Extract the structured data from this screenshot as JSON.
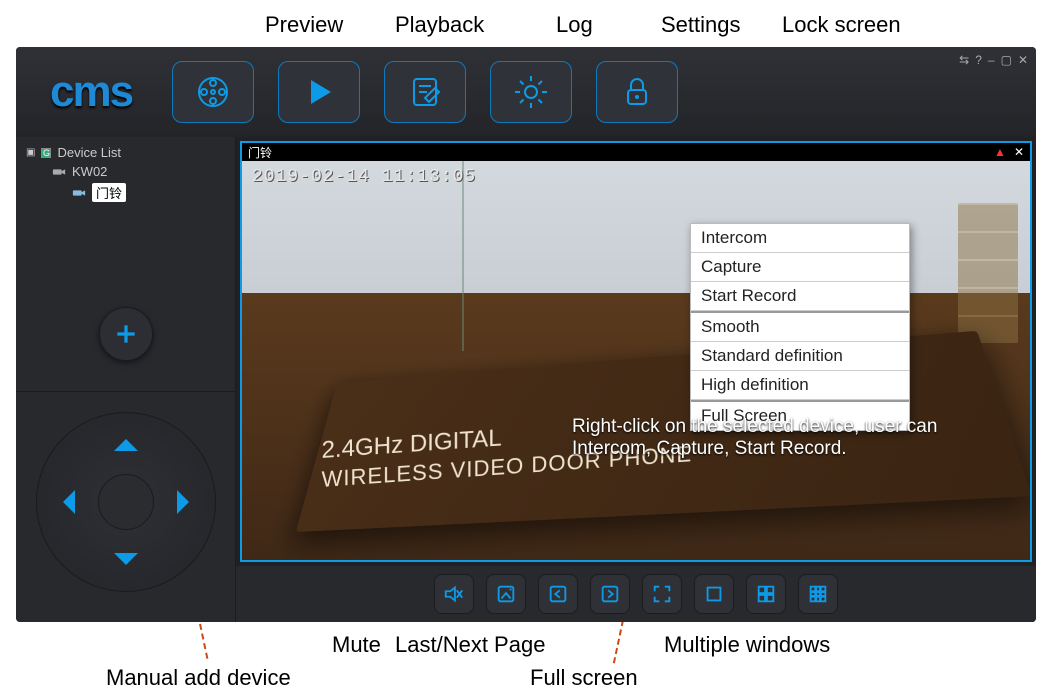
{
  "external_labels": {
    "preview": "Preview",
    "playback": "Playback",
    "log": "Log",
    "settings": "Settings",
    "lock": "Lock screen",
    "manual_add": "Manual add device",
    "mute": "Mute",
    "pages": "Last/Next Page",
    "fullscreen": "Full screen",
    "multi": "Multiple windows"
  },
  "logo_text": "cms",
  "device_tree": {
    "root": "Device List",
    "child": "KW02",
    "grandchild": "门铃"
  },
  "video": {
    "title": "门铃",
    "timestamp": "2019-02-14   11:13:05",
    "close_glyph": "✕",
    "box_line1": "2.4GHz DIGITAL",
    "box_line2": "WIRELESS VIDEO DOOR PHONE"
  },
  "caption": "Right-click on the selected device, user can Intercom, Capture, Start Record.",
  "context_menu": {
    "items": [
      "Intercom",
      "Capture",
      "Start Record",
      "Smooth",
      "Standard definition",
      "High definition",
      "Full Screen"
    ]
  },
  "window_controls": {
    "net": "⇆",
    "help": "?",
    "min": "–",
    "max": "▢",
    "close": "✕"
  }
}
